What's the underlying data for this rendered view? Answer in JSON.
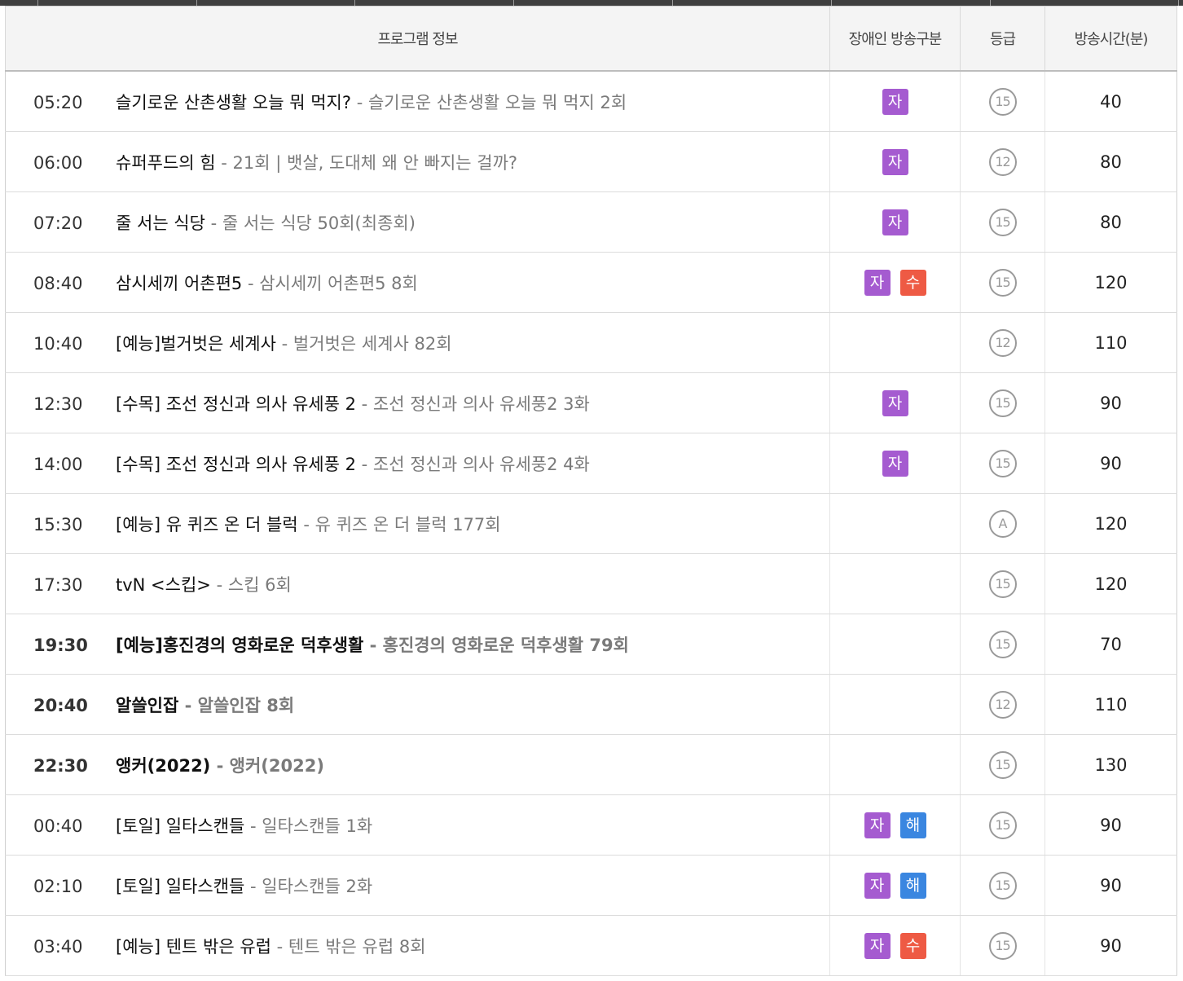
{
  "header": {
    "program_info": "프로그램 정보",
    "accessibility": "장애인 방송구분",
    "grade": "등급",
    "duration": "방송시간(분)"
  },
  "badge_colors": {
    "자": "#a55bd0",
    "수": "#ee5a44",
    "해": "#3a86e0"
  },
  "rows": [
    {
      "time": "05:20",
      "title": "슬기로운 산촌생활 오늘 뭐 먹지?",
      "sep": " - ",
      "episode": "슬기로운 산촌생활 오늘 뭐 먹지 2회",
      "badges": [
        "자"
      ],
      "grade": "15",
      "duration": "40",
      "bold": false
    },
    {
      "time": "06:00",
      "title": "슈퍼푸드의 힘",
      "sep": " - ",
      "episode": "21회 | 뱃살, 도대체 왜 안 빠지는 걸까?",
      "badges": [
        "자"
      ],
      "grade": "12",
      "duration": "80",
      "bold": false
    },
    {
      "time": "07:20",
      "title": "줄 서는 식당",
      "sep": " - ",
      "episode": "줄 서는 식당 50회(최종회)",
      "badges": [
        "자"
      ],
      "grade": "15",
      "duration": "80",
      "bold": false
    },
    {
      "time": "08:40",
      "title": "삼시세끼 어촌편5",
      "sep": " - ",
      "episode": "삼시세끼 어촌편5 8회",
      "badges": [
        "자",
        "수"
      ],
      "grade": "15",
      "duration": "120",
      "bold": false
    },
    {
      "time": "10:40",
      "title": "[예능]벌거벗은 세계사",
      "sep": " - ",
      "episode": "벌거벗은 세계사 82회",
      "badges": [],
      "grade": "12",
      "duration": "110",
      "bold": false
    },
    {
      "time": "12:30",
      "title": "[수목] 조선 정신과 의사 유세풍 2",
      "sep": " - ",
      "episode": "조선 정신과 의사 유세풍2 3화",
      "badges": [
        "자"
      ],
      "grade": "15",
      "duration": "90",
      "bold": false
    },
    {
      "time": "14:00",
      "title": "[수목] 조선 정신과 의사 유세풍 2",
      "sep": " - ",
      "episode": "조선 정신과 의사 유세풍2 4화",
      "badges": [
        "자"
      ],
      "grade": "15",
      "duration": "90",
      "bold": false
    },
    {
      "time": "15:30",
      "title": "[예능] 유 퀴즈 온 더 블럭",
      "sep": " - ",
      "episode": "유 퀴즈 온 더 블럭 177회",
      "badges": [],
      "grade": "A",
      "duration": "120",
      "bold": false
    },
    {
      "time": "17:30",
      "title": "tvN <스킵>",
      "sep": " - ",
      "episode": "스킵 6회",
      "badges": [],
      "grade": "15",
      "duration": "120",
      "bold": false
    },
    {
      "time": "19:30",
      "title": "[예능]홍진경의 영화로운 덕후생활",
      "sep": " - ",
      "episode": "홍진경의 영화로운 덕후생활 79회",
      "badges": [],
      "grade": "15",
      "duration": "70",
      "bold": true
    },
    {
      "time": "20:40",
      "title": "알쓸인잡",
      "sep": " - ",
      "episode": "알쓸인잡 8회",
      "badges": [],
      "grade": "12",
      "duration": "110",
      "bold": true
    },
    {
      "time": "22:30",
      "title": "앵커(2022)",
      "sep": " - ",
      "episode": "앵커(2022)",
      "badges": [],
      "grade": "15",
      "duration": "130",
      "bold": true
    },
    {
      "time": "00:40",
      "title": "[토일] 일타스캔들",
      "sep": " - ",
      "episode": "일타스캔들 1화",
      "badges": [
        "자",
        "해"
      ],
      "grade": "15",
      "duration": "90",
      "bold": false
    },
    {
      "time": "02:10",
      "title": "[토일] 일타스캔들",
      "sep": " - ",
      "episode": "일타스캔들 2화",
      "badges": [
        "자",
        "해"
      ],
      "grade": "15",
      "duration": "90",
      "bold": false
    },
    {
      "time": "03:40",
      "title": "[예능] 텐트 밖은 유럽",
      "sep": " - ",
      "episode": "텐트 밖은 유럽 8회",
      "badges": [
        "자",
        "수"
      ],
      "grade": "15",
      "duration": "90",
      "bold": false
    }
  ]
}
